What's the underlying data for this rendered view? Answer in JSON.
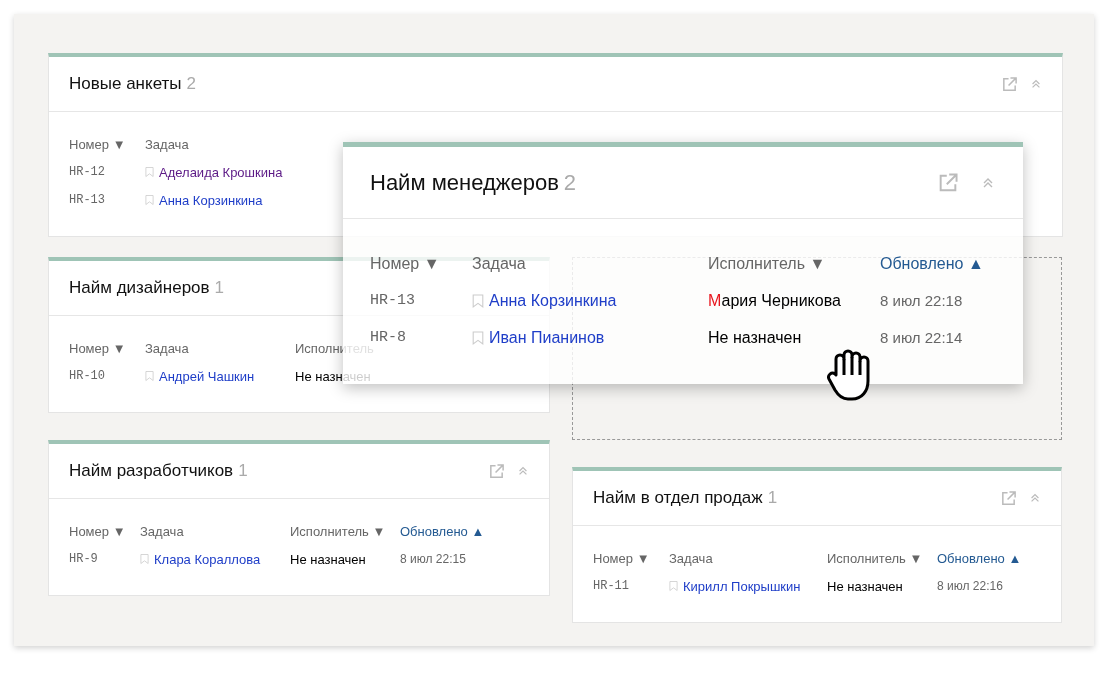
{
  "top_widget": {
    "title": "Новые анкеты",
    "count": "2",
    "columns": [
      {
        "label": "Номер",
        "mark": "▼",
        "active": false
      },
      {
        "label": "Задача",
        "active": false
      }
    ],
    "rows": [
      {
        "number": "HR-12",
        "task": "Аделаида Крошкина",
        "visited": true
      },
      {
        "number": "HR-13",
        "task": "Анна Корзинкина",
        "visited": false
      }
    ]
  },
  "left_widgets": [
    {
      "title": "Найм дизайнеров",
      "count": "1",
      "actions_hidden": true,
      "columns": [
        {
          "label": "Номер",
          "mark": "▼",
          "active": false
        },
        {
          "label": "Задача",
          "active": false
        },
        {
          "label": "Исполнитель",
          "active": false
        }
      ],
      "rows": [
        {
          "number": "HR-10",
          "task": "Андрей Чашкин",
          "visited": false,
          "assignee": "Не назначен",
          "highlight_initial": false
        }
      ]
    },
    {
      "title": "Найм разработчиков",
      "count": "1",
      "columns": [
        {
          "label": "Номер",
          "mark": "▼",
          "active": false
        },
        {
          "label": "Задача",
          "active": false
        },
        {
          "label": "Исполнитель",
          "mark": "▼",
          "active": false
        },
        {
          "label": "Обновлено",
          "mark": "▲",
          "active": true
        }
      ],
      "rows": [
        {
          "number": "HR-9",
          "task": "Клара Кораллова",
          "visited": false,
          "assignee": "Не назначен",
          "highlight_initial": false,
          "updated": "8 июл 22:15"
        }
      ]
    }
  ],
  "right_widgets": [
    {
      "title": "Найм в отдел продаж",
      "count": "1",
      "columns": [
        {
          "label": "Номер",
          "mark": "▼",
          "active": false
        },
        {
          "label": "Задача",
          "active": false
        },
        {
          "label": "Исполнитель",
          "mark": "▼",
          "active": false
        },
        {
          "label": "Обновлено",
          "mark": "▲",
          "active": true
        }
      ],
      "rows": [
        {
          "number": "HR-11",
          "task": "Кирилл Покрышкин",
          "visited": false,
          "assignee": "Не назначен",
          "highlight_initial": false,
          "updated": "8 июл 22:16"
        }
      ]
    }
  ],
  "dragged_widget": {
    "title": "Найм менеджеров",
    "count": "2",
    "dragging": true,
    "columns": [
      {
        "label": "Номер",
        "mark": "▼",
        "active": false
      },
      {
        "label": "Задача",
        "active": false
      },
      {
        "label": "Исполнитель",
        "mark": "▼",
        "active": false
      },
      {
        "label": "Обновлено",
        "mark": "▲",
        "active": true
      }
    ],
    "rows": [
      {
        "number": "HR-13",
        "task": "Анна Корзинкина",
        "visited": false,
        "assignee": "Мария Черникова",
        "highlight_initial": true,
        "updated": "8 июл 22:18"
      },
      {
        "number": "HR-8",
        "task": "Иван Пианинов",
        "visited": false,
        "assignee": "Не назначен",
        "highlight_initial": false,
        "updated": "8 июл 22:14"
      }
    ]
  }
}
